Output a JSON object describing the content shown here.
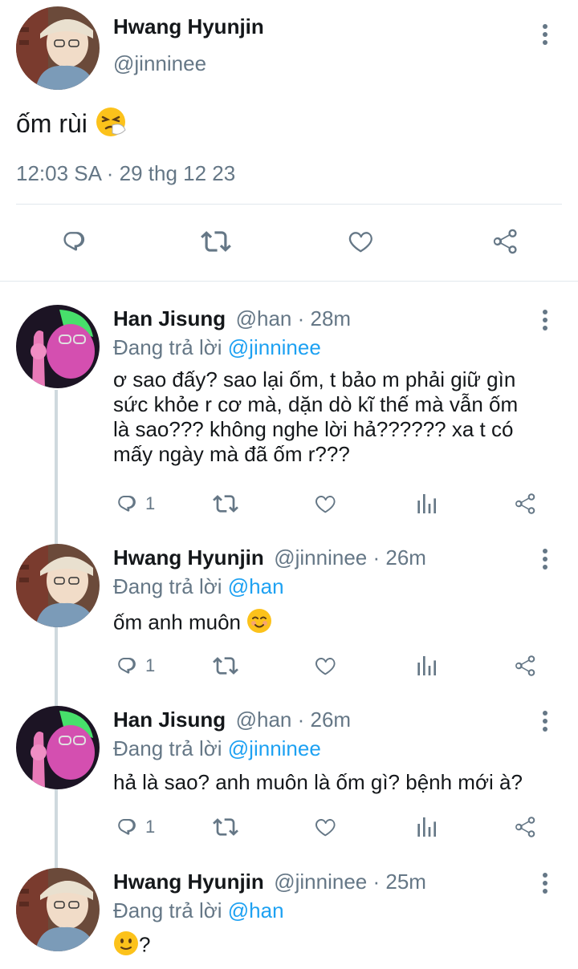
{
  "main_tweet": {
    "author_name": "Hwang Hyunjin",
    "author_handle": "@jinninee",
    "text": "ốm rùi",
    "emoji": "sneezing-face",
    "timestamp": "12:03 SA · 29 thg 12 23",
    "actions": [
      "reply-icon",
      "retweet-icon",
      "like-icon",
      "share-icon"
    ]
  },
  "replies": [
    {
      "author_name": "Han Jisung",
      "author_handle": "@han",
      "time": " · 28m",
      "replying_prefix": "Đang trả lời ",
      "replying_to": "@jinninee",
      "lines": [
        "ơ sao đấy? sao lại ốm, t bảo m phải giữ gìn",
        "sức khỏe r cơ mà, dặn dò kĩ thế mà vẫn ốm",
        "là sao??? không nghe lời hả?????? xa t có",
        "mấy ngày mà đã ốm r???"
      ],
      "reply_count": "1"
    },
    {
      "author_name": "Hwang Hyunjin",
      "author_handle": "@jinninee",
      "time": " · 26m",
      "replying_prefix": "Đang trả lời ",
      "replying_to": "@han",
      "text": "ốm anh muôn",
      "emoji": "smiling-face",
      "reply_count": "1"
    },
    {
      "author_name": "Han Jisung",
      "author_handle": "@han",
      "time": " · 26m",
      "replying_prefix": "Đang trả lời ",
      "replying_to": "@jinninee",
      "text": "hả là sao? anh muôn là ốm gì? bệnh mới à?",
      "reply_count": "1"
    },
    {
      "author_name": "Hwang Hyunjin",
      "author_handle": "@jinninee",
      "time": " · 25m",
      "replying_prefix": "Đang trả lời ",
      "replying_to": "@han",
      "text": "?",
      "emoji": "slightly-smiling-face"
    }
  ],
  "colors": {
    "link": "#1da1f2",
    "secondary_text": "#657786",
    "divider": "#e1e8ed",
    "thread_line": "#cfd9de"
  }
}
